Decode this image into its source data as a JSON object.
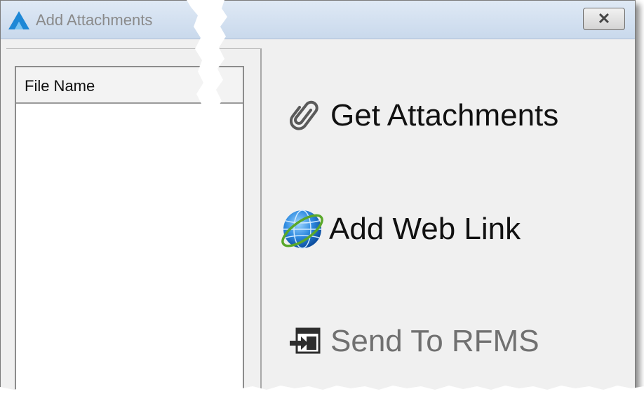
{
  "window": {
    "title": "Add Attachments",
    "app_icon": "app-logo-icon",
    "close_icon": "close-icon"
  },
  "file_list": {
    "column_header": "File Name"
  },
  "actions": [
    {
      "label": "Get Attachments",
      "icon": "paperclip-icon"
    },
    {
      "label": "Add Web Link",
      "icon": "globe-icon"
    },
    {
      "label": "Send To RFMS",
      "icon": "send-icon"
    }
  ],
  "colors": {
    "title_text": "#8a8a8a",
    "label_enabled": "#111111",
    "label_disabled": "#707070",
    "logo_blue": "#1e88d6"
  }
}
